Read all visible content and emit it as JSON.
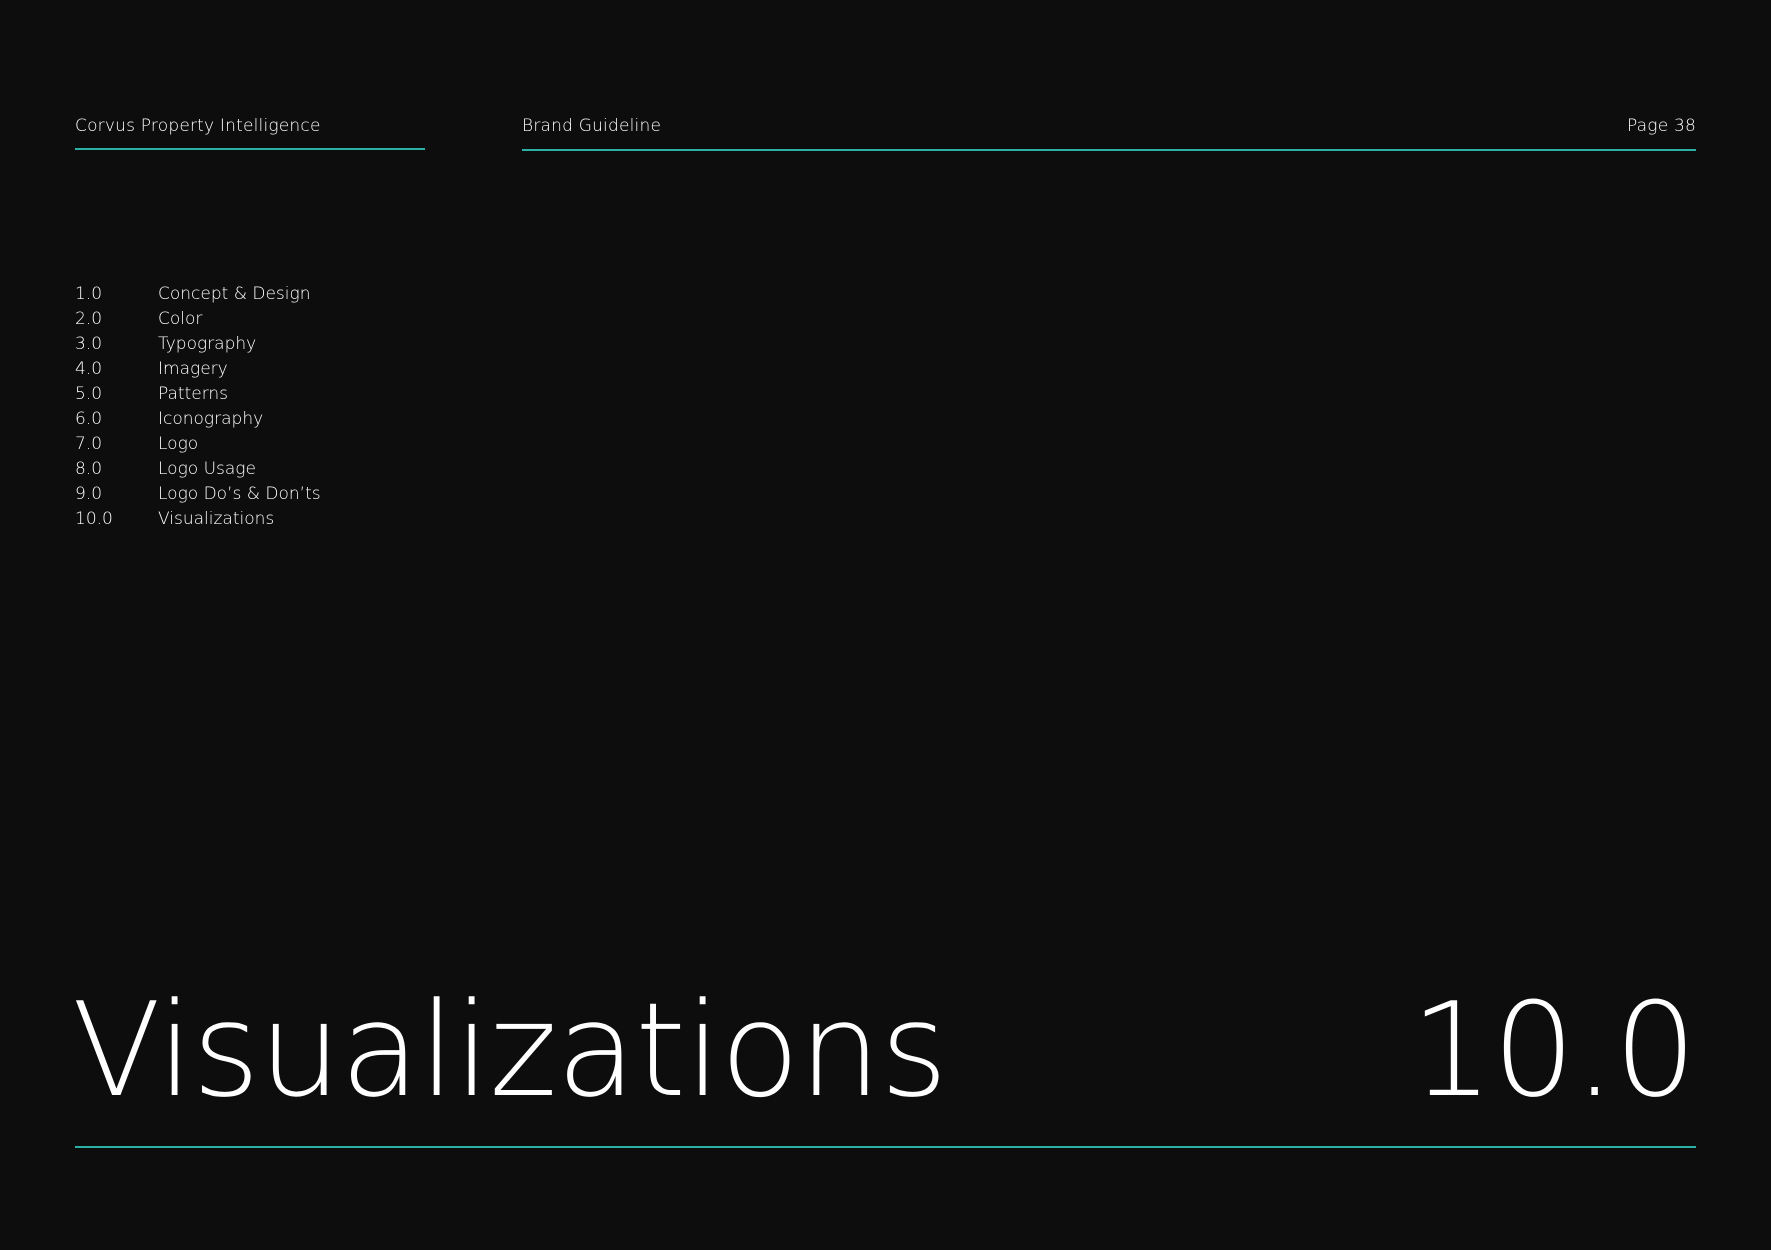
{
  "header": {
    "company": "Corvus Property Intelligence",
    "document_title": "Brand Guideline",
    "page_label": "Page 38"
  },
  "toc": [
    {
      "number": "1.0",
      "label": "Concept & Design"
    },
    {
      "number": "2.0",
      "label": "Color"
    },
    {
      "number": "3.0",
      "label": "Typography"
    },
    {
      "number": "4.0",
      "label": "Imagery"
    },
    {
      "number": "5.0",
      "label": "Patterns"
    },
    {
      "number": "6.0",
      "label": "Iconography"
    },
    {
      "number": "7.0",
      "label": "Logo"
    },
    {
      "number": "8.0",
      "label": "Logo Usage"
    },
    {
      "number": "9.0",
      "label": "Logo Do’s & Don’ts"
    },
    {
      "number": "10.0",
      "label": "Visualizations"
    }
  ],
  "section": {
    "title": "Visualizations",
    "number": "10.0"
  },
  "colors": {
    "background": "#0d0d0d",
    "accent": "#2bb0a8",
    "text": "#ffffff"
  }
}
